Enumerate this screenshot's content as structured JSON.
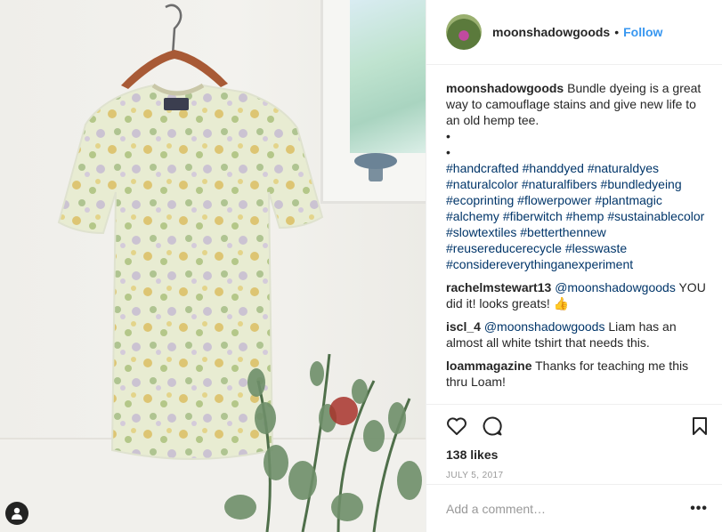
{
  "post": {
    "username": "moonshadowgoods",
    "follow_label": "Follow",
    "separator": "•"
  },
  "caption": {
    "username": "moonshadowgoods",
    "text": "Bundle dyeing is a great way to camouflage stains and give new life to an old hemp tee.",
    "bullets": [
      "•",
      "•"
    ],
    "hashtags": [
      "#handcrafted",
      "#handdyed",
      "#naturaldyes",
      "#naturalcolor",
      "#naturalfibers",
      "#bundledyeing",
      "#ecoprinting",
      "#flowerpower",
      "#plantmagic",
      "#alchemy",
      "#fiberwitch",
      "#hemp",
      "#sustainablecolor",
      "#slowtextiles",
      "#betterthennew",
      "#reusereducerecycle",
      "#lesswaste",
      "#considereverythinganexperiment"
    ]
  },
  "comments": [
    {
      "username": "rachelmstewart13",
      "mention": "@moonshadowgoods",
      "text": "YOU did it! looks greats! 👍"
    },
    {
      "username": "iscl_4",
      "mention": "@moonshadowgoods",
      "text": "Liam has an almost all white tshirt that needs this."
    },
    {
      "username": "loammagazine",
      "mention": "",
      "text": "Thanks for teaching me this thru Loam!"
    }
  ],
  "stats": {
    "likes": "138 likes",
    "date": "JULY 5, 2017"
  },
  "add_comment": {
    "placeholder": "Add a comment…",
    "more": "•••"
  },
  "icons": {
    "like": "heart-icon",
    "comment": "comment-icon",
    "save": "bookmark-icon",
    "tagged": "person-icon"
  },
  "colors": {
    "link": "#3897f0",
    "hashtag": "#003569",
    "text": "#262626",
    "muted": "#999999"
  }
}
